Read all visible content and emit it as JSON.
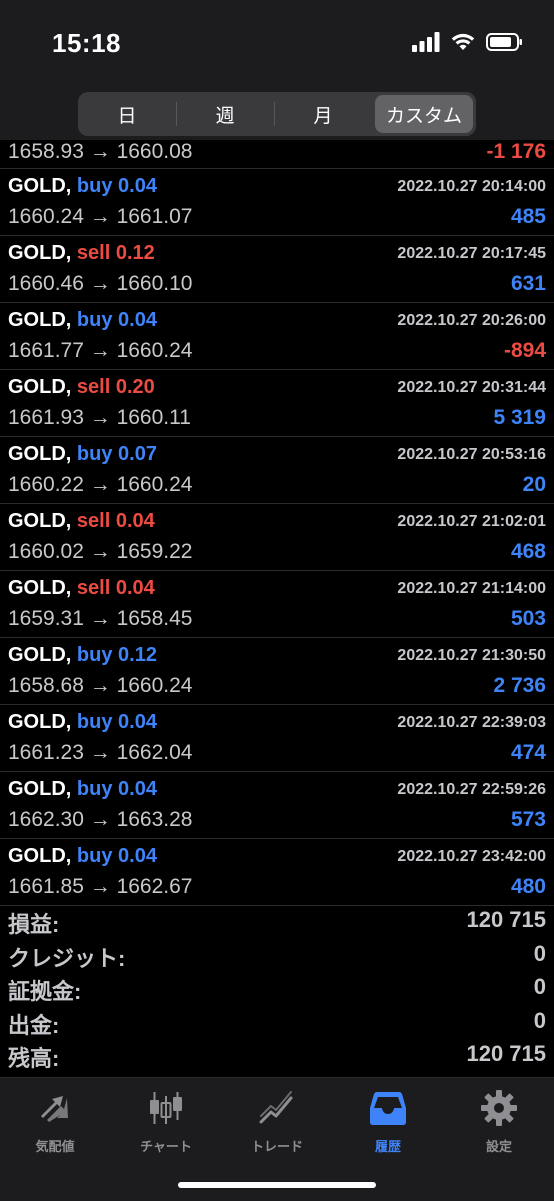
{
  "status": {
    "time": "15:18"
  },
  "segments": [
    {
      "label": "日",
      "active": false
    },
    {
      "label": "週",
      "active": false
    },
    {
      "label": "月",
      "active": false
    },
    {
      "label": "カスタム",
      "active": true
    }
  ],
  "first_row": {
    "prices": "1658.93 → 1660.08",
    "pnl": "-1 176"
  },
  "trades": [
    {
      "symbol": "GOLD,",
      "side": "buy",
      "volume": "buy 0.04",
      "datetime": "2022.10.27 20:14:00",
      "prices": "1660.24 → 1661.07",
      "pnl": "485"
    },
    {
      "symbol": "GOLD,",
      "side": "sell",
      "volume": "sell 0.12",
      "datetime": "2022.10.27 20:17:45",
      "prices": "1660.46 → 1660.10",
      "pnl": "631"
    },
    {
      "symbol": "GOLD,",
      "side": "buy",
      "volume": "buy 0.04",
      "datetime": "2022.10.27 20:26:00",
      "prices": "1661.77 → 1660.24",
      "pnl": "-894"
    },
    {
      "symbol": "GOLD,",
      "side": "sell",
      "volume": "sell 0.20",
      "datetime": "2022.10.27 20:31:44",
      "prices": "1661.93 → 1660.11",
      "pnl": "5 319"
    },
    {
      "symbol": "GOLD,",
      "side": "buy",
      "volume": "buy 0.07",
      "datetime": "2022.10.27 20:53:16",
      "prices": "1660.22 → 1660.24",
      "pnl": "20"
    },
    {
      "symbol": "GOLD,",
      "side": "sell",
      "volume": "sell 0.04",
      "datetime": "2022.10.27 21:02:01",
      "prices": "1660.02 → 1659.22",
      "pnl": "468"
    },
    {
      "symbol": "GOLD,",
      "side": "sell",
      "volume": "sell 0.04",
      "datetime": "2022.10.27 21:14:00",
      "prices": "1659.31 → 1658.45",
      "pnl": "503"
    },
    {
      "symbol": "GOLD,",
      "side": "buy",
      "volume": "buy 0.12",
      "datetime": "2022.10.27 21:30:50",
      "prices": "1658.68 → 1660.24",
      "pnl": "2 736"
    },
    {
      "symbol": "GOLD,",
      "side": "buy",
      "volume": "buy 0.04",
      "datetime": "2022.10.27 22:39:03",
      "prices": "1661.23 → 1662.04",
      "pnl": "474"
    },
    {
      "symbol": "GOLD,",
      "side": "buy",
      "volume": "buy 0.04",
      "datetime": "2022.10.27 22:59:26",
      "prices": "1662.30 → 1663.28",
      "pnl": "573"
    },
    {
      "symbol": "GOLD,",
      "side": "buy",
      "volume": "buy 0.04",
      "datetime": "2022.10.27 23:42:00",
      "prices": "1661.85 → 1662.67",
      "pnl": "480"
    }
  ],
  "summary": [
    {
      "label": "損益:",
      "value": "120 715"
    },
    {
      "label": "クレジット:",
      "value": "0"
    },
    {
      "label": "証拠金:",
      "value": "0"
    },
    {
      "label": "出金:",
      "value": "0"
    },
    {
      "label": "残高:",
      "value": "120 715"
    }
  ],
  "tabs": [
    {
      "label": "気配値",
      "icon": "quotes-arrows-icon",
      "active": false
    },
    {
      "label": "チャート",
      "icon": "candlestick-icon",
      "active": false
    },
    {
      "label": "トレード",
      "icon": "trade-line-icon",
      "active": false
    },
    {
      "label": "履歴",
      "icon": "history-tray-icon",
      "active": true
    },
    {
      "label": "設定",
      "icon": "gear-icon",
      "active": false
    }
  ],
  "colors": {
    "buy": "#3f83f8",
    "sell": "#ec4b43",
    "active_tab": "#3f83f8"
  }
}
